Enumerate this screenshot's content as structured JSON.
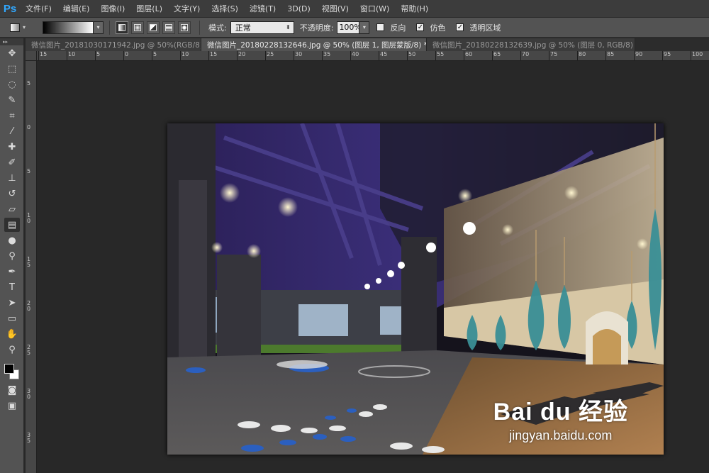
{
  "app": {
    "logo": "Ps"
  },
  "menu": [
    "文件(F)",
    "编辑(E)",
    "图像(I)",
    "图层(L)",
    "文字(Y)",
    "选择(S)",
    "滤镜(T)",
    "3D(D)",
    "视图(V)",
    "窗口(W)",
    "帮助(H)"
  ],
  "options": {
    "mode_label": "模式:",
    "mode_value": "正常",
    "opacity_label": "不透明度:",
    "opacity_value": "100%",
    "reverse_label": "反向",
    "dither_label": "仿色",
    "transparency_label": "透明区域",
    "reverse_checked": false,
    "dither_checked": true,
    "transparency_checked": true
  },
  "tabs": [
    {
      "label": "微信图片_20181030171942.jpg @ 50%(RGB/8)",
      "active": false
    },
    {
      "label": "微信图片_20180228132646.jpg @ 50% (图层 1, 图层蒙版/8) *",
      "active": true
    },
    {
      "label": "微信图片_20180228132639.jpg @ 50% (图层 0, RGB/8) *",
      "active": false
    }
  ],
  "tab_close": "×",
  "ruler_top_labels": [
    "15",
    "10",
    "5",
    "0",
    "5",
    "10",
    "15",
    "20",
    "25",
    "30",
    "35",
    "40",
    "45",
    "50",
    "55",
    "60",
    "65",
    "70",
    "75",
    "80",
    "85",
    "90",
    "95",
    "100"
  ],
  "ruler_left_labels": [
    "5",
    "0",
    "5",
    "1\n0",
    "1\n5",
    "2\n0",
    "2\n5",
    "3\n0",
    "3\n5"
  ],
  "watermark": {
    "logo": "Bai du 经验",
    "url": "jingyan.baidu.com"
  },
  "colors": {
    "foreground": "#000000",
    "background": "#ffffff",
    "accent": "#31a8ff"
  }
}
